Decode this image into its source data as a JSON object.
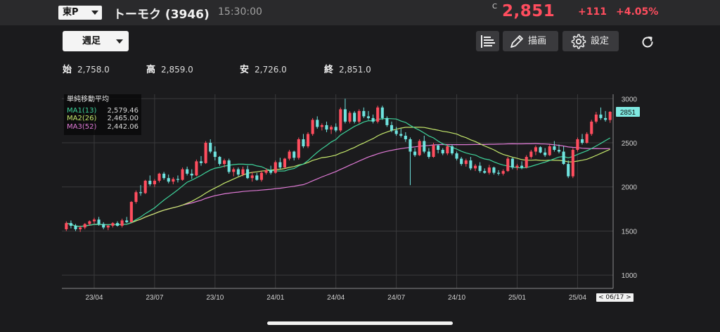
{
  "header": {
    "market": "東P",
    "stock_name": "トーモク (3946)",
    "time": "15:30:00",
    "price_prefix": "C",
    "price": "2,851",
    "change": "+111",
    "change_pct": "+4.05%"
  },
  "toolbar": {
    "period": "週足",
    "draw_label": "描画",
    "settings_label": "設定"
  },
  "ohlc": {
    "open_label": "始",
    "open": "2,758.0",
    "high_label": "高",
    "high": "2,859.0",
    "low_label": "安",
    "low": "2,726.0",
    "close_label": "終",
    "close": "2,851.0"
  },
  "legend": {
    "title": "単純移動平均",
    "ma1_label": "MA1(13)",
    "ma1_value": "2,579.46",
    "ma2_label": "MA2(26)",
    "ma2_value": "2,465.00",
    "ma3_label": "MA3(52)",
    "ma3_value": "2,442.06"
  },
  "date_badge": "< 06/17 >",
  "colors": {
    "up": "#ff4d5e",
    "down": "#6fe3df",
    "ma1": "#3ed39b",
    "ma2": "#c5e86c",
    "ma3": "#e07ad6",
    "price_tag": "#7fe9e1"
  },
  "chart_data": {
    "type": "candlestick",
    "ylim": [
      850,
      3050
    ],
    "y_ticks": [
      1000,
      1500,
      2000,
      2500,
      3000
    ],
    "x_ticks": [
      "23/04",
      "23/07",
      "23/10",
      "24/01",
      "24/04",
      "24/07",
      "24/10",
      "25/01",
      "25/04"
    ],
    "x_tick_index": [
      6,
      19,
      32,
      45,
      58,
      71,
      84,
      97,
      110
    ],
    "last_price_label": "2851",
    "candles": [
      [
        1520,
        1610,
        1500,
        1590
      ],
      [
        1590,
        1620,
        1530,
        1560
      ],
      [
        1560,
        1580,
        1500,
        1520
      ],
      [
        1520,
        1560,
        1490,
        1540
      ],
      [
        1540,
        1590,
        1520,
        1580
      ],
      [
        1580,
        1620,
        1560,
        1610
      ],
      [
        1610,
        1650,
        1580,
        1630
      ],
      [
        1630,
        1660,
        1560,
        1580
      ],
      [
        1580,
        1600,
        1520,
        1540
      ],
      [
        1540,
        1570,
        1510,
        1560
      ],
      [
        1560,
        1600,
        1540,
        1590
      ],
      [
        1590,
        1610,
        1550,
        1560
      ],
      [
        1560,
        1640,
        1540,
        1620
      ],
      [
        1620,
        1660,
        1590,
        1600
      ],
      [
        1600,
        1840,
        1600,
        1830
      ],
      [
        1830,
        1960,
        1810,
        1940
      ],
      [
        1940,
        2020,
        1900,
        1930
      ],
      [
        1930,
        2080,
        1920,
        2070
      ],
      [
        2070,
        2130,
        2010,
        2030
      ],
      [
        2030,
        2090,
        2000,
        2070
      ],
      [
        2070,
        2160,
        2050,
        2150
      ],
      [
        2150,
        2170,
        2080,
        2100
      ],
      [
        2100,
        2140,
        2040,
        2060
      ],
      [
        2060,
        2110,
        2030,
        2090
      ],
      [
        2090,
        2130,
        2050,
        2080
      ],
      [
        2080,
        2220,
        2070,
        2200
      ],
      [
        2200,
        2230,
        2130,
        2150
      ],
      [
        2150,
        2200,
        2090,
        2130
      ],
      [
        2130,
        2310,
        2120,
        2290
      ],
      [
        2290,
        2350,
        2240,
        2270
      ],
      [
        2270,
        2520,
        2260,
        2500
      ],
      [
        2500,
        2540,
        2380,
        2400
      ],
      [
        2400,
        2460,
        2300,
        2340
      ],
      [
        2340,
        2350,
        2240,
        2260
      ],
      [
        2260,
        2320,
        2220,
        2300
      ],
      [
        2300,
        2320,
        2150,
        2170
      ],
      [
        2170,
        2220,
        2120,
        2200
      ],
      [
        2200,
        2220,
        2120,
        2140
      ],
      [
        2140,
        2230,
        2120,
        2200
      ],
      [
        2200,
        2240,
        2090,
        2100
      ],
      [
        2100,
        2170,
        2060,
        2130
      ],
      [
        2130,
        2160,
        2070,
        2080
      ],
      [
        2080,
        2180,
        2060,
        2160
      ],
      [
        2160,
        2210,
        2140,
        2190
      ],
      [
        2190,
        2240,
        2140,
        2160
      ],
      [
        2160,
        2300,
        2150,
        2280
      ],
      [
        2280,
        2330,
        2200,
        2220
      ],
      [
        2220,
        2330,
        2210,
        2320
      ],
      [
        2320,
        2420,
        2300,
        2400
      ],
      [
        2400,
        2410,
        2300,
        2330
      ],
      [
        2330,
        2560,
        2310,
        2540
      ],
      [
        2540,
        2600,
        2440,
        2460
      ],
      [
        2460,
        2620,
        2440,
        2600
      ],
      [
        2600,
        2780,
        2580,
        2760
      ],
      [
        2760,
        2800,
        2660,
        2680
      ],
      [
        2680,
        2720,
        2640,
        2700
      ],
      [
        2700,
        2740,
        2620,
        2650
      ],
      [
        2650,
        2700,
        2600,
        2680
      ],
      [
        2680,
        2720,
        2620,
        2640
      ],
      [
        2640,
        2900,
        2620,
        2880
      ],
      [
        2880,
        3000,
        2720,
        2740
      ],
      [
        2740,
        2860,
        2720,
        2840
      ],
      [
        2840,
        2860,
        2720,
        2740
      ],
      [
        2740,
        2880,
        2720,
        2860
      ],
      [
        2860,
        2900,
        2780,
        2800
      ],
      [
        2800,
        2860,
        2760,
        2780
      ],
      [
        2780,
        2820,
        2720,
        2740
      ],
      [
        2740,
        2920,
        2720,
        2900
      ],
      [
        2900,
        2920,
        2760,
        2780
      ],
      [
        2780,
        2800,
        2680,
        2700
      ],
      [
        2700,
        2740,
        2620,
        2640
      ],
      [
        2640,
        2680,
        2580,
        2600
      ],
      [
        2600,
        2660,
        2560,
        2580
      ],
      [
        2580,
        2620,
        2510,
        2540
      ],
      [
        2540,
        2560,
        2020,
        2400
      ],
      [
        2400,
        2440,
        2340,
        2360
      ],
      [
        2360,
        2540,
        2350,
        2520
      ],
      [
        2520,
        2580,
        2380,
        2400
      ],
      [
        2400,
        2440,
        2320,
        2340
      ],
      [
        2340,
        2500,
        2330,
        2470
      ],
      [
        2470,
        2480,
        2380,
        2420
      ],
      [
        2420,
        2440,
        2360,
        2380
      ],
      [
        2380,
        2480,
        2360,
        2460
      ],
      [
        2460,
        2480,
        2360,
        2380
      ],
      [
        2380,
        2400,
        2300,
        2320
      ],
      [
        2320,
        2340,
        2240,
        2260
      ],
      [
        2260,
        2320,
        2230,
        2300
      ],
      [
        2300,
        2340,
        2190,
        2210
      ],
      [
        2210,
        2260,
        2180,
        2240
      ],
      [
        2240,
        2280,
        2160,
        2180
      ],
      [
        2180,
        2210,
        2150,
        2160
      ],
      [
        2160,
        2250,
        2140,
        2220
      ],
      [
        2220,
        2230,
        2140,
        2160
      ],
      [
        2160,
        2190,
        2130,
        2150
      ],
      [
        2150,
        2200,
        2130,
        2180
      ],
      [
        2180,
        2340,
        2170,
        2320
      ],
      [
        2320,
        2330,
        2200,
        2220
      ],
      [
        2220,
        2260,
        2190,
        2240
      ],
      [
        2240,
        2290,
        2200,
        2220
      ],
      [
        2220,
        2360,
        2210,
        2340
      ],
      [
        2340,
        2420,
        2320,
        2400
      ],
      [
        2400,
        2470,
        2360,
        2450
      ],
      [
        2450,
        2460,
        2380,
        2390
      ],
      [
        2390,
        2440,
        2340,
        2360
      ],
      [
        2360,
        2480,
        2350,
        2460
      ],
      [
        2460,
        2520,
        2400,
        2420
      ],
      [
        2420,
        2480,
        2380,
        2400
      ],
      [
        2400,
        2460,
        2250,
        2260
      ],
      [
        2260,
        2300,
        2100,
        2120
      ],
      [
        2120,
        2440,
        2100,
        2420
      ],
      [
        2420,
        2560,
        2400,
        2540
      ],
      [
        2540,
        2600,
        2480,
        2500
      ],
      [
        2500,
        2620,
        2490,
        2600
      ],
      [
        2600,
        2760,
        2580,
        2740
      ],
      [
        2740,
        2850,
        2720,
        2820
      ],
      [
        2820,
        2900,
        2760,
        2780
      ],
      [
        2780,
        2860,
        2740,
        2760
      ],
      [
        2758,
        2859,
        2726,
        2851
      ]
    ]
  }
}
